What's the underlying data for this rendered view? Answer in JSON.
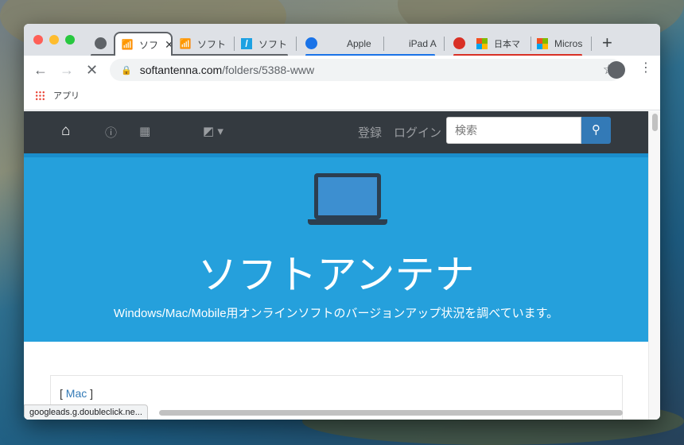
{
  "tabs": [
    {
      "label": "ソフ",
      "active": true
    },
    {
      "label": "ソフト"
    },
    {
      "label": "ソフト"
    },
    {
      "label": "Apple"
    },
    {
      "label": "iPad A"
    },
    {
      "label": "日本マ"
    },
    {
      "label": "Micros"
    }
  ],
  "toolbar": {
    "url_domain": "softantenna.com",
    "url_path": "/folders/5388-www"
  },
  "bookmarks": {
    "apps_label": "アプリ"
  },
  "site_nav": {
    "register": "登録",
    "login": "ログイン",
    "search_placeholder": "検索"
  },
  "hero": {
    "title": "ソフトアンテナ",
    "subtitle": "Windows/Mac/Mobile用オンラインソフトのバージョンアップ状況を調べています。"
  },
  "content": {
    "bracket_open": "[ ",
    "category_link": "Mac",
    "bracket_close": " ]"
  },
  "status_bar": {
    "text": "googleads.g.doubleclick.ne..."
  },
  "colors": {
    "nav_bg": "#343a40",
    "hero_bg": "#25a0dc",
    "search_btn": "#337ab7",
    "group_blue": "#1a73e8",
    "group_red": "#d93025"
  }
}
